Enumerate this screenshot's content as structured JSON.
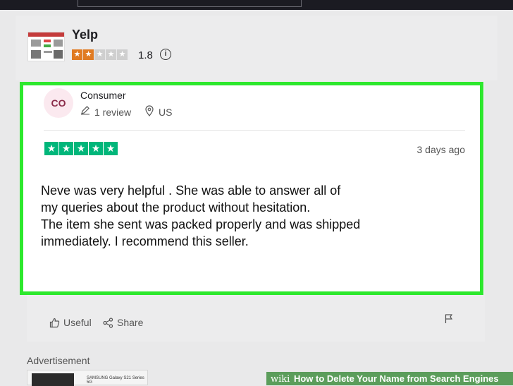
{
  "company": {
    "name": "Yelp",
    "rating": "1.8",
    "stars_filled": 2,
    "stars_total": 5,
    "info_icon": "info-icon"
  },
  "review": {
    "avatar_initials": "CO",
    "reviewer_name": "Consumer",
    "review_count": "1 review",
    "location": "US",
    "stars_filled": 5,
    "date": "3 days ago",
    "text": "Neve was very helpful . She was able to answer all of\nmy queries about the product without hesitation.\nThe item she sent was packed properly and was shipped\n immediately.  I recommend this seller."
  },
  "actions": {
    "useful_label": "Useful",
    "share_label": "Share",
    "useful_icon": "thumbs-up-icon",
    "share_icon": "share-icon",
    "flag_icon": "flag-icon"
  },
  "advertisement_label": "Advertisement",
  "ad_text": "SAMSUNG  Galaxy S21 Series 5G",
  "watermark": {
    "brand": "wiki",
    "title": "How to Delete Your Name from Search Engines"
  },
  "colors": {
    "highlight_border": "#2de82d",
    "star_green": "#00b67a",
    "star_orange": "#e07b22",
    "watermark_green": "#3c8c3c"
  }
}
